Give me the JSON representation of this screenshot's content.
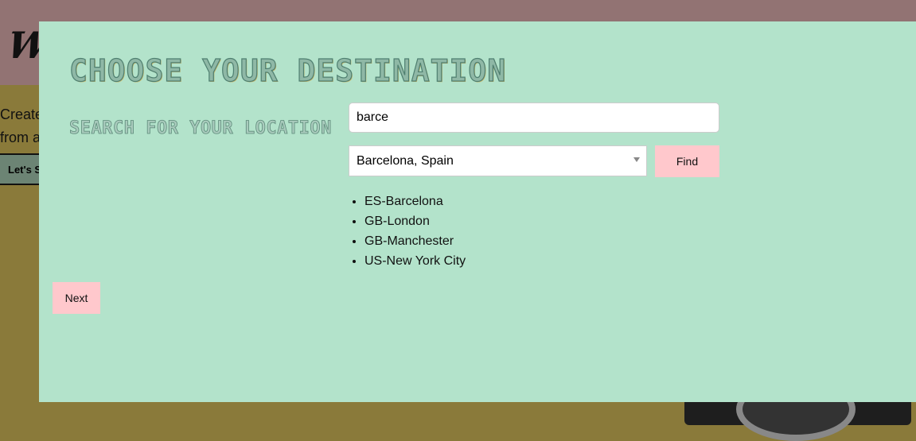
{
  "background": {
    "logo": "W",
    "text_lines": [
      "Create",
      "from a"
    ],
    "button": "Let's S"
  },
  "modal": {
    "title": "CHOOSE YOUR DESTINATION",
    "subtitle": "SEARCH FOR YOUR LOCATION",
    "search_value": "barce",
    "select_value": "Barcelona, Spain",
    "find_label": "Find",
    "next_label": "Next",
    "locations": [
      "ES-Barcelona",
      "GB-London",
      "GB-Manchester",
      "US-New York City"
    ]
  },
  "colors": {
    "modal_bg": "#b3e3cb",
    "button_bg": "#ffc8cc",
    "top_band": "#927373",
    "page_bg": "#8a7a3a"
  }
}
